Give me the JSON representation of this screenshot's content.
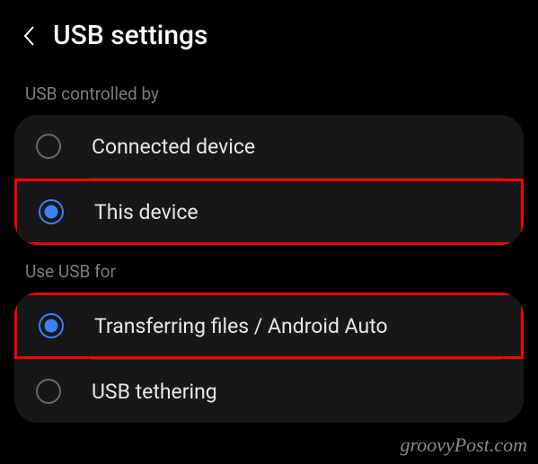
{
  "header": {
    "title": "USB settings"
  },
  "sections": {
    "controlled_by": {
      "label": "USB controlled by",
      "options": {
        "connected_device": "Connected device",
        "this_device": "This device"
      }
    },
    "use_for": {
      "label": "Use USB for",
      "options": {
        "transferring_files": "Transferring files / Android Auto",
        "usb_tethering": "USB tethering"
      }
    }
  },
  "watermark": "groovyPost.com"
}
